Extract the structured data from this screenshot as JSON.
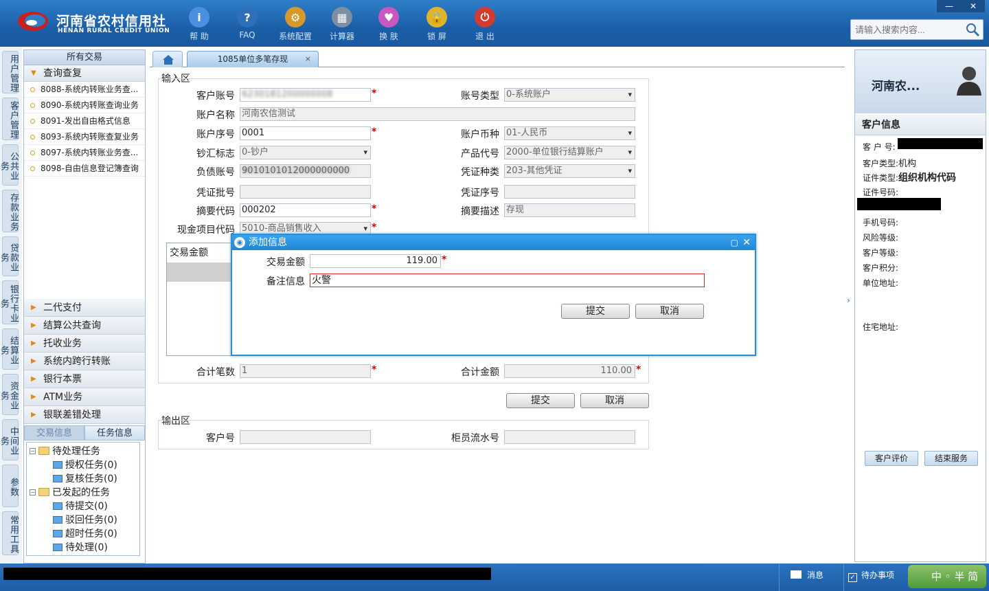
{
  "app": {
    "logo_cn": "河南省农村信用社",
    "logo_en": "HENAN RURAL CREDIT UNION"
  },
  "toolbar": [
    {
      "label": "帮 助",
      "icon": "info-icon",
      "color": "#4a8fe0",
      "glyph": "i"
    },
    {
      "label": "FAQ",
      "icon": "question-icon",
      "color": "#2d6fb8",
      "glyph": "?"
    },
    {
      "label": "系统配置",
      "icon": "toolbox-icon",
      "color": "#d79a2a",
      "glyph": "⚙"
    },
    {
      "label": "计算器",
      "icon": "calculator-icon",
      "color": "#7c8fa3",
      "glyph": "▦"
    },
    {
      "label": "换 肤",
      "icon": "shirt-icon",
      "color": "#c858c0",
      "glyph": "♥"
    },
    {
      "label": "锁 屏",
      "icon": "lock-icon",
      "color": "#e0b52a",
      "glyph": "🔒"
    },
    {
      "label": "退 出",
      "icon": "power-icon",
      "color": "#d33b2f",
      "glyph": "⏻"
    }
  ],
  "search": {
    "placeholder": "请输入搜索内容..."
  },
  "vtabs": [
    "用户管理",
    "客户管理",
    "公共业务",
    "存款业务",
    "贷款业务",
    "银行卡业务",
    "结算业务",
    "资金业务",
    "中间业务",
    "参数",
    "常用工具"
  ],
  "leftmenu": {
    "header": "所有交易",
    "open_group": "查询查复",
    "items": [
      "8088-系统内转账业务查...",
      "8090-系统内转账查询业务",
      "8091-发出自由格式信息",
      "8093-系统内转账查复业务",
      "8097-系统内转账业务查...",
      "8098-自由信息登记簿查询"
    ],
    "groups": [
      "二代支付",
      "结算公共查询",
      "托收业务",
      "系统内跨行转账",
      "银行本票",
      "ATM业务",
      "银联差错处理"
    ],
    "task_tabs": [
      "交易信息",
      "任务信息"
    ],
    "tree": [
      {
        "label": "待处理任务",
        "type": "folder",
        "level": 0
      },
      {
        "label": "授权任务(0)",
        "type": "leaf",
        "level": 1
      },
      {
        "label": "复核任务(0)",
        "type": "leaf",
        "level": 1
      },
      {
        "label": "已发起的任务",
        "type": "folder",
        "level": 0
      },
      {
        "label": "待提交(0)",
        "type": "leaf",
        "level": 1
      },
      {
        "label": "驳回任务(0)",
        "type": "leaf",
        "level": 1
      },
      {
        "label": "超时任务(0)",
        "type": "leaf",
        "level": 1
      },
      {
        "label": "待处理(0)",
        "type": "leaf",
        "level": 1
      }
    ]
  },
  "tab": {
    "title": "1085单位多笔存现",
    "close": "×"
  },
  "form": {
    "input_section": "输入区",
    "customer_account_label": "客户账号",
    "customer_account": "6230181200000008",
    "account_type_label": "账号类型",
    "account_type": "0-系统账户",
    "account_name_label": "账户名称",
    "account_name": "河南农信测试",
    "account_seq_label": "账户序号",
    "account_seq": "0001",
    "currency_label": "账户币种",
    "currency": "01-人民币",
    "cash_flag_label": "钞汇标志",
    "cash_flag": "0-钞户",
    "product_code_label": "产品代号",
    "product_code": "2000-单位银行结算账户",
    "liability_account_label": "负债账号",
    "liability_account": "9010101012000000000",
    "voucher_type_label": "凭证种类",
    "voucher_type": "203-其他凭证",
    "voucher_batch_label": "凭证批号",
    "voucher_batch": "",
    "voucher_seq_label": "凭证序号",
    "voucher_seq": "",
    "summary_code_label": "摘要代码",
    "summary_code": "000202",
    "summary_desc_label": "摘要描述",
    "summary_desc": "存现",
    "cash_item_label": "现金项目代码",
    "cash_item": "5010-商品销售收入",
    "grid_header": "交易金额",
    "total_count_label": "合计笔数",
    "total_count": "1",
    "total_amount_label": "合计金额",
    "total_amount": "110.00",
    "submit": "提交",
    "cancel": "取消",
    "output_section": "输出区",
    "out_customer_label": "客户号",
    "out_customer": "",
    "teller_serial_label": "柜员流水号",
    "teller_serial": ""
  },
  "dialog": {
    "title": "添加信息",
    "amount_label": "交易金额",
    "amount": "119.00",
    "remark_label": "备注信息",
    "remark": "火警",
    "submit": "提交",
    "cancel": "取消"
  },
  "customer": {
    "name": "河南农...",
    "section": "客户信息",
    "id_label": "客 户 号:",
    "type_label": "客户类型:",
    "type": "机构",
    "doc_type_label": "证件类型:",
    "doc_type": "组织机构代码",
    "doc_no_label": "证件号码:",
    "phone_label": "手机号码:",
    "risk_label": "风险等级:",
    "level_label": "客户等级:",
    "points_label": "客户积分:",
    "company_addr_label": "单位地址:",
    "home_addr_label": "住宅地址:",
    "rate_btn": "客户评价",
    "end_btn": "结束服务"
  },
  "status": {
    "messages": "消息",
    "todo": "待办事项",
    "ime": "中 ◦ 半 简"
  }
}
